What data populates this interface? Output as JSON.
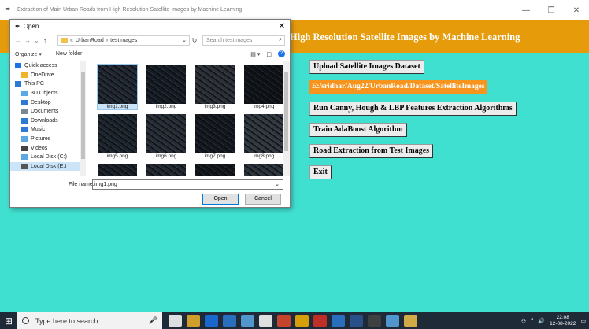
{
  "window": {
    "title": "Extraction of Main Urban Roads from High Resolution Satellite Images by Machine Learning",
    "controls": [
      "—",
      "❐",
      "✕"
    ]
  },
  "header": {
    "title": "High Resolution Satellite Images by Machine Learning"
  },
  "buttons": {
    "upload": "Upload Satellite Images Dataset",
    "dataset_path": "E:/sridhar/Aug22/UrbanRoad/Dataset/SatelliteImages",
    "features": "Run Canny, Hough & LBP Features Extraction Algorithms",
    "train": "Train AdaBoost Algorithm",
    "road": "Road Extraction from Test Images",
    "exit": "Exit"
  },
  "dialog": {
    "title": "Open",
    "breadcrumb": [
      "«",
      "UrbanRoad",
      "›",
      "testImages"
    ],
    "search_placeholder": "Search testImages",
    "organize": "Organize ▾",
    "new_folder": "New folder",
    "nav_items": [
      {
        "label": "Quick access",
        "icon": "star-icon",
        "color": "#1a73e8"
      },
      {
        "label": "OneDrive",
        "icon": "cloud-icon",
        "color": "#f0b429"
      },
      {
        "label": "This PC",
        "icon": "computer-icon",
        "color": "#2b7bd6"
      },
      {
        "label": "3D Objects",
        "icon": "cube-icon",
        "color": "#5aa9e6"
      },
      {
        "label": "Desktop",
        "icon": "desktop-icon",
        "color": "#2b7bd6"
      },
      {
        "label": "Documents",
        "icon": "document-icon",
        "color": "#7a8794"
      },
      {
        "label": "Downloads",
        "icon": "download-icon",
        "color": "#2b7bd6"
      },
      {
        "label": "Music",
        "icon": "music-icon",
        "color": "#2b7bd6"
      },
      {
        "label": "Pictures",
        "icon": "picture-icon",
        "color": "#5aa9e6"
      },
      {
        "label": "Videos",
        "icon": "video-icon",
        "color": "#444"
      },
      {
        "label": "Local Disk (C:)",
        "icon": "disk-icon",
        "color": "#5aa9e6"
      },
      {
        "label": "Local Disk (E:)",
        "icon": "disk-icon",
        "color": "#555"
      }
    ],
    "files": [
      "img1.png",
      "img2.png",
      "img3.png",
      "img4.png",
      "img5.png",
      "img6.png",
      "img7.png",
      "img8.png",
      "",
      "",
      "",
      ""
    ],
    "selected_file": "img1.png",
    "file_name_label": "File name:",
    "file_name_value": "img1.png",
    "open": "Open",
    "cancel": "Cancel"
  },
  "taskbar": {
    "search_placeholder": "Type here to search",
    "time": "22:08",
    "date": "12-08-2022"
  }
}
